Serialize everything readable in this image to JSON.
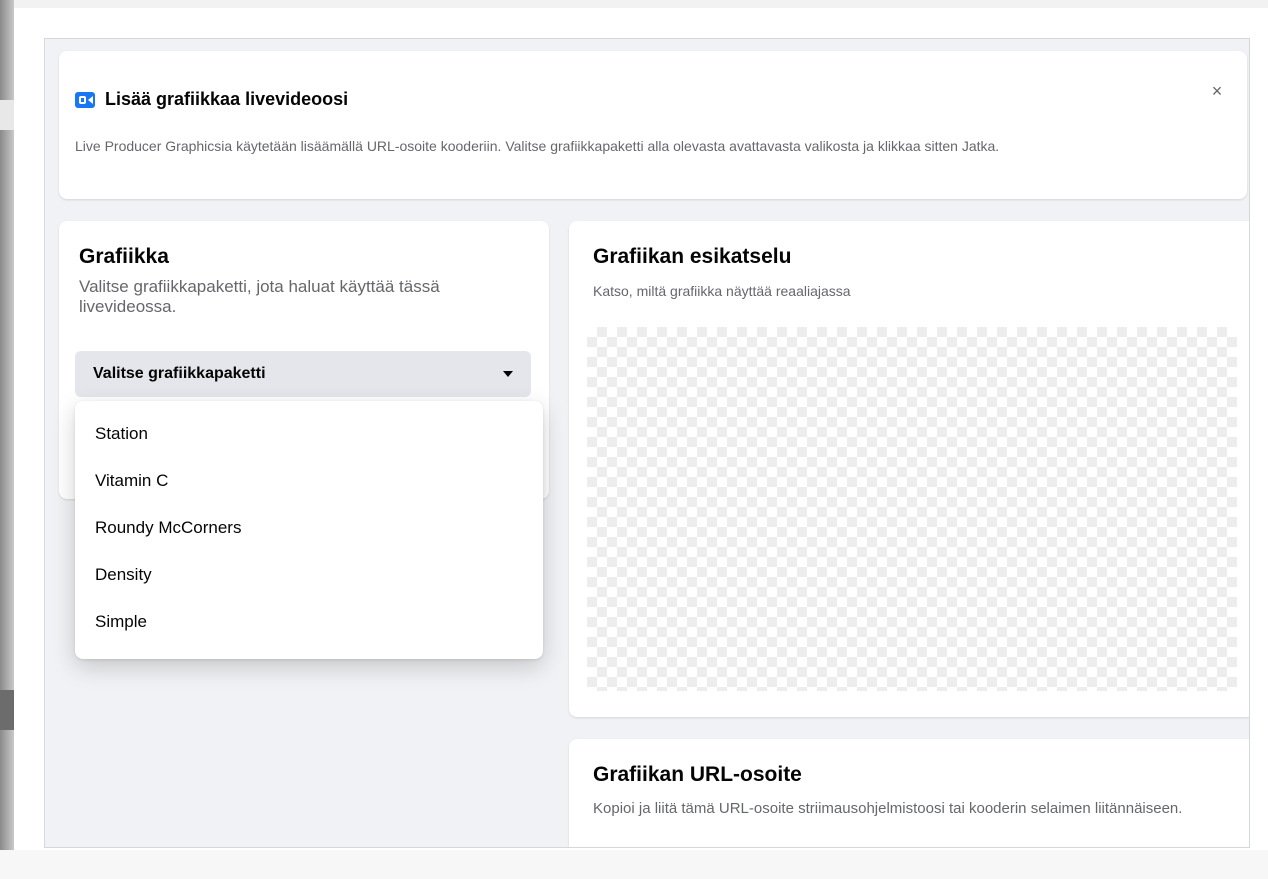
{
  "header": {
    "title": "Lisää grafiikkaa livevideoosi",
    "close_label": "×",
    "description": "Live Producer Graphicsia käytetään lisäämällä URL-osoite kooderiin. Valitse grafiikkapaketti alla olevasta avattavasta valikosta ja klikkaa sitten Jatka."
  },
  "graphics": {
    "title": "Grafiikka",
    "subtitle": "Valitse grafiikkapaketti, jota haluat käyttää tässä livevideossa.",
    "select_label": "Valitse grafiikkapaketti",
    "options": [
      "Station",
      "Vitamin C",
      "Roundy McCorners",
      "Density",
      "Simple"
    ]
  },
  "preview": {
    "title": "Grafiikan esikatselu",
    "subtitle": "Katso, miltä grafiikka näyttää reaaliajassa"
  },
  "url": {
    "title": "Grafiikan URL-osoite",
    "description": "Kopioi ja liitä tämä URL-osoite striimausohjelmistoosi tai kooderin selaimen liitännäiseen."
  },
  "colors": {
    "accent": "#1877f2",
    "panel_bg": "#f0f2f5",
    "select_bg": "#e4e6eb"
  },
  "icons": {
    "header": "video-camera-icon",
    "close": "close-icon",
    "select": "caret-down-icon"
  }
}
